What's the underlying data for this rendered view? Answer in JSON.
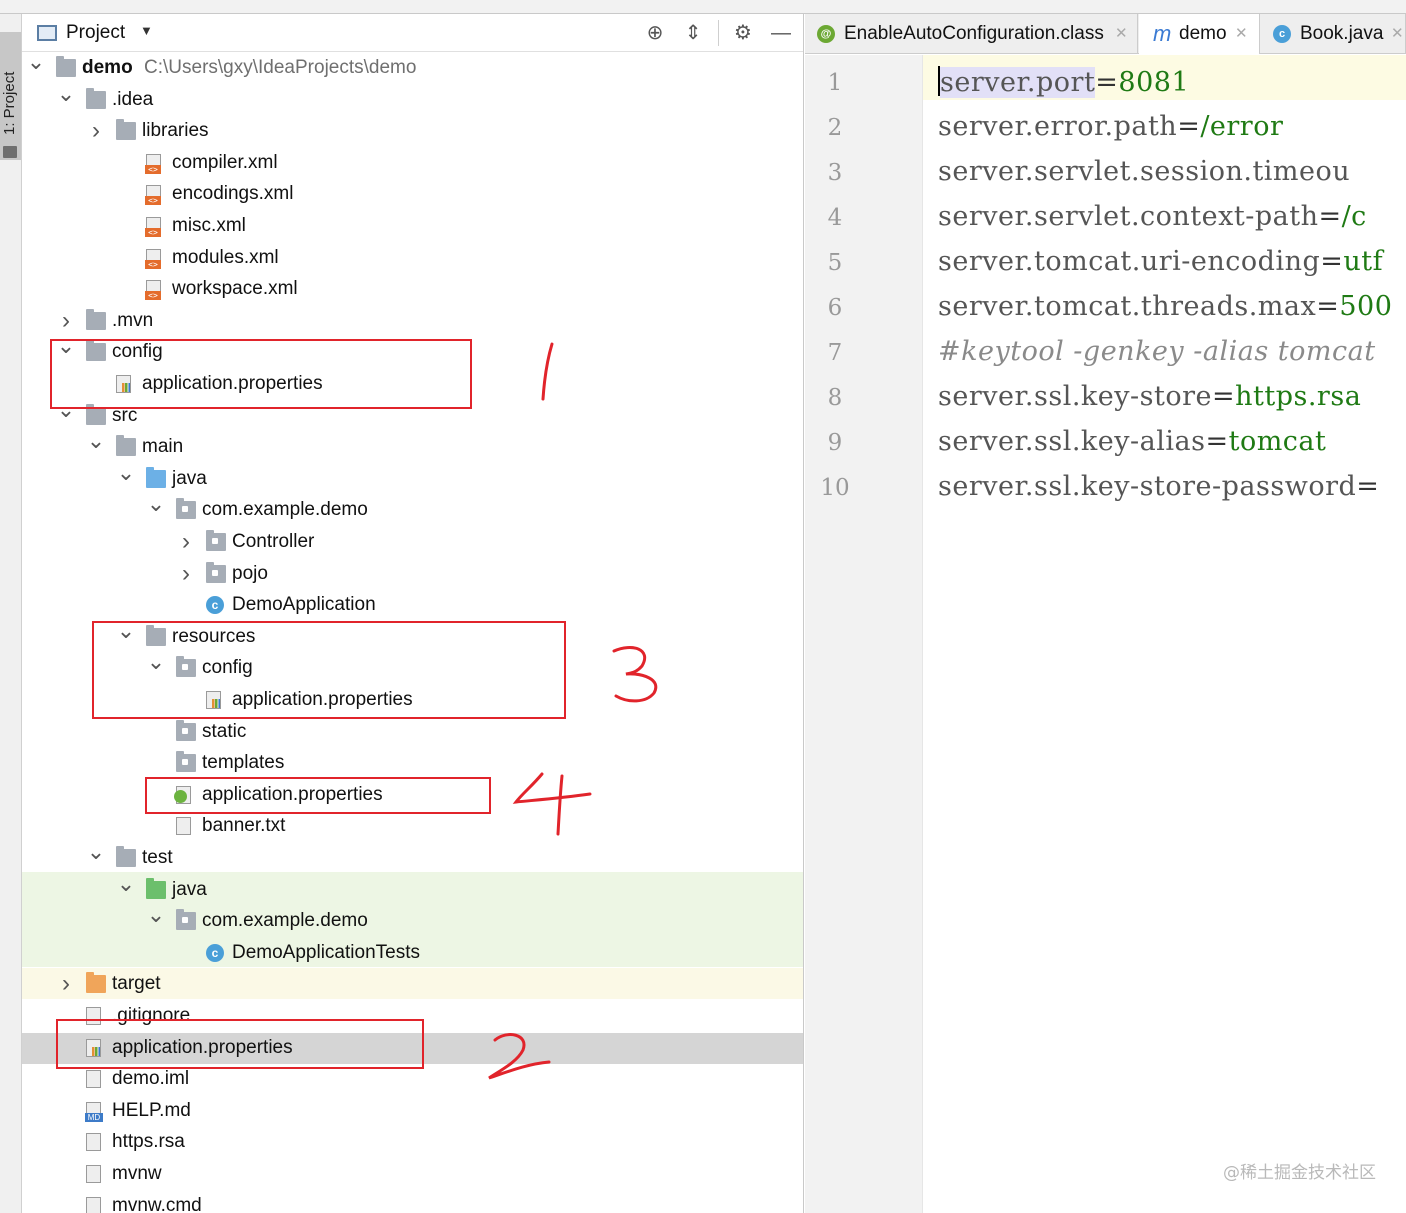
{
  "tool_window": {
    "strip_label": "1: Project"
  },
  "project_panel": {
    "title": "Project",
    "tree": [
      {
        "name": "demo",
        "path": "C:\\Users\\gxy\\IdeaProjects\\demo",
        "expanded": true
      },
      {
        "name": ".idea",
        "expanded": true
      },
      {
        "name": "libraries",
        "expanded": false
      },
      {
        "name": "compiler.xml"
      },
      {
        "name": "encodings.xml"
      },
      {
        "name": "misc.xml"
      },
      {
        "name": "modules.xml"
      },
      {
        "name": "workspace.xml"
      },
      {
        "name": ".mvn",
        "expanded": false
      },
      {
        "name": "config",
        "expanded": true
      },
      {
        "name": "application.properties"
      },
      {
        "name": "src",
        "expanded": true
      },
      {
        "name": "main",
        "expanded": true
      },
      {
        "name": "java",
        "expanded": true
      },
      {
        "name": "com.example.demo",
        "expanded": true
      },
      {
        "name": "Controller",
        "expanded": false
      },
      {
        "name": "pojo",
        "expanded": false
      },
      {
        "name": "DemoApplication"
      },
      {
        "name": "resources",
        "expanded": true
      },
      {
        "name": "config",
        "expanded": true
      },
      {
        "name": "application.properties"
      },
      {
        "name": "static"
      },
      {
        "name": "templates"
      },
      {
        "name": "application.properties"
      },
      {
        "name": "banner.txt"
      },
      {
        "name": "test",
        "expanded": true
      },
      {
        "name": "java",
        "expanded": true
      },
      {
        "name": "com.example.demo",
        "expanded": true
      },
      {
        "name": "DemoApplicationTests"
      },
      {
        "name": "target",
        "expanded": false
      },
      {
        "name": ".gitignore"
      },
      {
        "name": "application.properties",
        "selected": true
      },
      {
        "name": "demo.iml"
      },
      {
        "name": "HELP.md"
      },
      {
        "name": "https.rsa"
      },
      {
        "name": "mvnw"
      },
      {
        "name": "mvnw.cmd"
      }
    ]
  },
  "annotations": [
    "1",
    "2",
    "3",
    "4"
  ],
  "editor": {
    "tabs": [
      {
        "icon": "annotation-class-icon",
        "label": "EnableAutoConfiguration.class"
      },
      {
        "icon": "maven-icon",
        "label": "demo"
      },
      {
        "icon": "class-icon",
        "label": "Book.java"
      }
    ],
    "lines": [
      {
        "num": "1",
        "key": "server.port",
        "eq": "=",
        "value": "8081"
      },
      {
        "num": "2",
        "key": "server.error.path",
        "eq": "=",
        "value": "/error"
      },
      {
        "num": "3",
        "key": "server.servlet.session.timeou",
        "eq": "",
        "value": ""
      },
      {
        "num": "4",
        "key": "server.servlet.context-path",
        "eq": "=",
        "value": "/c"
      },
      {
        "num": "5",
        "key": "server.tomcat.uri-encoding",
        "eq": "=",
        "value": "utf"
      },
      {
        "num": "6",
        "key": "server.tomcat.threads.max",
        "eq": "=",
        "value": "500"
      },
      {
        "num": "7",
        "comment": "#keytool -genkey -alias tomcat"
      },
      {
        "num": "8",
        "key": "server.ssl.key-store",
        "eq": "=",
        "value": "https.rsa"
      },
      {
        "num": "9",
        "key": "server.ssl.key-alias",
        "eq": "=",
        "value": "tomcat"
      },
      {
        "num": "10",
        "key": "server.ssl.key-store-password",
        "eq": "=",
        "value": ""
      }
    ]
  },
  "watermark": "@稀土掘金技术社区",
  "colors": {
    "selection": "#d5d5d5",
    "annotation_red": "#e1242b",
    "value_green": "#1f7a14",
    "test_band": "#edf6e4",
    "target_band": "#fbf9e6"
  }
}
